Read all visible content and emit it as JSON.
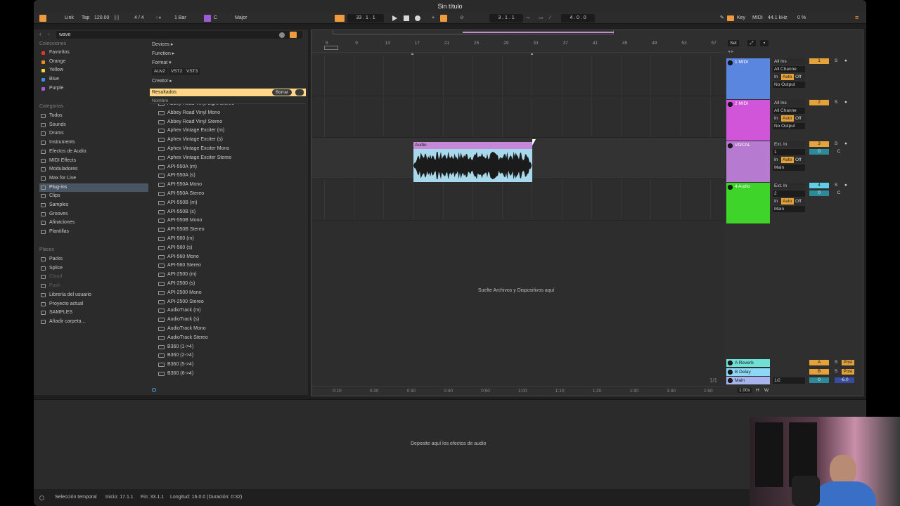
{
  "window": {
    "title": "Sin título"
  },
  "transport": {
    "link": "Link",
    "tap": "Tap",
    "tempo": "120.00",
    "signature": "4 / 4",
    "quantization": "1 Bar",
    "key_root": "C",
    "key_scale": "Major",
    "position": "33 .  1 .  1",
    "loop_start": "3 .  1 .  1",
    "loop_length": "4 .  0 .  0",
    "key_label": "Key",
    "midi_label": "MIDI",
    "sample_rate": "44.1 kHz",
    "cpu": "0 %"
  },
  "browser": {
    "search_value": "wave",
    "collections_title": "Colecciones",
    "collections": [
      {
        "label": "Favoritos",
        "color": "#e0362e"
      },
      {
        "label": "Orange",
        "color": "#ee8a26"
      },
      {
        "label": "Yellow",
        "color": "#f5d630"
      },
      {
        "label": "Blue",
        "color": "#3a8de6"
      },
      {
        "label": "Purple",
        "color": "#a65ad6"
      }
    ],
    "categories_title": "Categorías",
    "categories": [
      "Todos",
      "Sounds",
      "Drums",
      "Instruments",
      "Efectos de Audio",
      "MIDI Effects",
      "Moduladores",
      "Max for Live",
      "Plug-ins",
      "Clips",
      "Samples",
      "Grooves",
      "Afinaciones",
      "Plantillas"
    ],
    "selected_category": "Plug-ins",
    "places_title": "Places",
    "places": [
      "Packs",
      "Splice",
      "Cloud",
      "Push",
      "Librería del usuario",
      "Proyecto actual",
      "SAMPLES",
      "Añadir carpeta..."
    ],
    "filters": {
      "devices": "Devices ▸",
      "function": "Function ▸",
      "format": "Format ▾",
      "creator": "Creator ▸"
    },
    "format_tags": [
      "AUv2",
      "VST2",
      "VST3"
    ],
    "results_label": "Resultados",
    "clear_label": "Borrar",
    "name_header": "Nombre",
    "results": [
      "Abbey Road Vinyl Light Stereo",
      "Abbey Road Vinyl Mono",
      "Abbey Road Vinyl Stereo",
      "Aphex Vintage Exciter (m)",
      "Aphex Vintage Exciter (s)",
      "Aphex Vintage Exciter Mono",
      "Aphex Vintage Exciter Stereo",
      "API-550A (m)",
      "API-550A (s)",
      "API-550A Mono",
      "API-550A Stereo",
      "API-550B (m)",
      "API-550B (s)",
      "API-550B Mono",
      "API-550B Stereo",
      "API-560 (m)",
      "API-560 (s)",
      "API-560 Mono",
      "API-560 Stereo",
      "API-2500 (m)",
      "API-2500 (s)",
      "API-2500 Mono",
      "API-2500 Stereo",
      "AudioTrack (m)",
      "AudioTrack (s)",
      "AudioTrack Mono",
      "AudioTrack Stereo",
      "B360 (1->4)",
      "B360 (2->4)",
      "B360 (5->4)",
      "B360 (6->4)"
    ]
  },
  "arrangement": {
    "bar_markers": [
      "5",
      "9",
      "13",
      "17",
      "21",
      "25",
      "29",
      "33",
      "37",
      "41",
      "45",
      "49",
      "53",
      "57"
    ],
    "set_label": "Set",
    "drop_hint": "Suelte Archivos y Dispositivos aquí",
    "clip_name": "Audio",
    "time_markers": [
      "0:10",
      "0:20",
      "0:30",
      "0:40",
      "0:50",
      "1:00",
      "1:10",
      "1:20",
      "1:30",
      "1:40",
      "1:50"
    ],
    "page_indicator": "1/1",
    "zoom": "1.00x",
    "h_label": "H",
    "w_label": "W"
  },
  "tracks": [
    {
      "name": "1 MIDI",
      "color": "#5b86e0",
      "input": "All Ins",
      "channel": "All Channe",
      "monitor": [
        "In",
        "Auto",
        "Off"
      ],
      "output": "No Output",
      "number": "1"
    },
    {
      "name": "2 MIDI",
      "color": "#d155d8",
      "input": "All Ins",
      "channel": "All Channe",
      "monitor": [
        "In",
        "Auto",
        "Off"
      ],
      "output": "No Output",
      "number": "2"
    },
    {
      "name": "VOCAL",
      "color": "#b67ad0",
      "input": "Ext. In",
      "channel": "1",
      "monitor": [
        "In",
        "Auto",
        "Off"
      ],
      "output": "Main",
      "number": "3",
      "vol": "0",
      "pan": "C"
    },
    {
      "name": "4 Audio",
      "color": "#3fd42a",
      "input": "Ext. In",
      "channel": "2",
      "monitor": [
        "In",
        "Auto",
        "Off"
      ],
      "output": "Main",
      "number": "4",
      "vol": "0",
      "pan": "C"
    }
  ],
  "returns": [
    {
      "name": "A Reverb",
      "color": "#6fe0d6",
      "letter": "A",
      "post": "Post"
    },
    {
      "name": "B Delay",
      "color": "#8fd8f5",
      "letter": "B",
      "post": "Post"
    },
    {
      "name": "Main",
      "color": "#a7b4ee",
      "output": "1/2",
      "vol": "0",
      "pan": "-6.0"
    }
  ],
  "detail": {
    "drop_hint": "Deposite aquí los efectos de audio"
  },
  "status": {
    "selection": "Selección temporal",
    "start": "Inicio: 17.1.1",
    "end": "Fin: 33.1.1",
    "length": "Longitud: 16.0.0 (Duración: 0:32)"
  }
}
